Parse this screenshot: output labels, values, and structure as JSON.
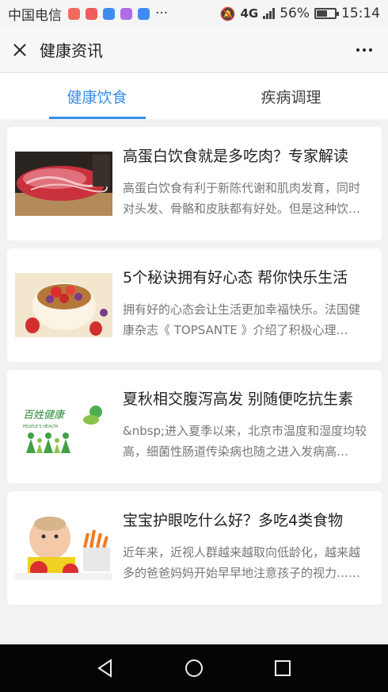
{
  "status_bar": {
    "carrier": "中国电信",
    "more": "···",
    "network": "4G",
    "battery": "56%",
    "battery_level": 0.56,
    "time": "15:14",
    "app_icon_colors": [
      "#f16b5c",
      "#f25c5c",
      "#3f8cf0",
      "#b06de6",
      "#3f8cf0"
    ]
  },
  "nav": {
    "title": "健康资讯"
  },
  "tabs": [
    {
      "label": "健康饮食",
      "active": true
    },
    {
      "label": "疾病调理",
      "active": false
    }
  ],
  "articles": [
    {
      "title": "高蛋白饮食就是多吃肉？专家解读",
      "desc": "高蛋白饮食有利于新陈代谢和肌肉发育，同时对头发、骨骼和皮肤都有好处。但是这种饮食方式……",
      "thumb": "raw-meat-slices"
    },
    {
      "title": "5个秘诀拥有好心态 帮你快乐生活",
      "desc": "拥有好的心态会让生活更加幸福快乐。法国健康杂志《 TOPSANTE 》介绍了积极心理学……",
      "thumb": "fruit-bowl"
    },
    {
      "title": "夏秋相交腹泻高发 别随便吃抗生素",
      "desc": "&nbsp;进入夏季以来，北京市温度和湿度均较高，细菌性肠道传染病也随之进入发病高峰……",
      "thumb": "peoples-health-logo",
      "logo_text": "百姓健康",
      "logo_sub": "PEOPLE'S HEALTH"
    },
    {
      "title": "宝宝护眼吃什么好？多吃4类食物",
      "desc": "近年来，近视人群越来越取向低龄化，越来越多的爸爸妈妈开始早早地注意孩子的视力……",
      "thumb": "baby-with-fruit"
    }
  ]
}
